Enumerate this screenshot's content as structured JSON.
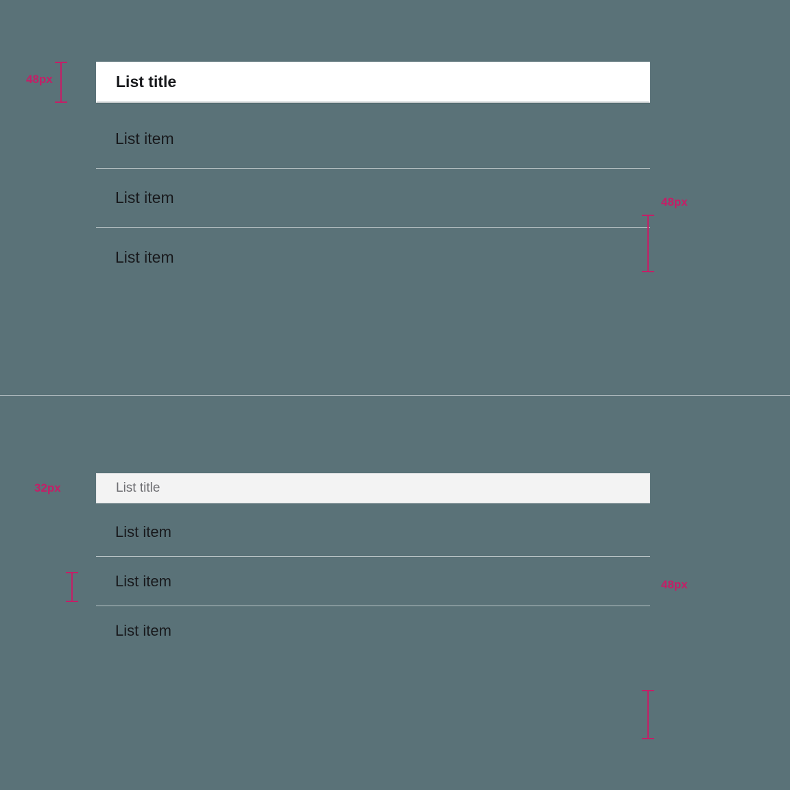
{
  "colors": {
    "background": "#5a7278",
    "measure": "#c31f67",
    "title_bar_1_bg": "#ffffff",
    "title_bar_2_bg": "#f3f3f3",
    "text_primary": "#18191c",
    "text_secondary": "#6e6e72",
    "divider": "#b8c3c5"
  },
  "panel1": {
    "title": "List title",
    "title_height_label": "48px",
    "row_height_label": "48px",
    "items": [
      "List item",
      "List item",
      "List item"
    ]
  },
  "panel2": {
    "title": "List title",
    "title_height_label": "32px",
    "row_height_label": "48px",
    "items": [
      "List item",
      "List item",
      "List item"
    ]
  }
}
